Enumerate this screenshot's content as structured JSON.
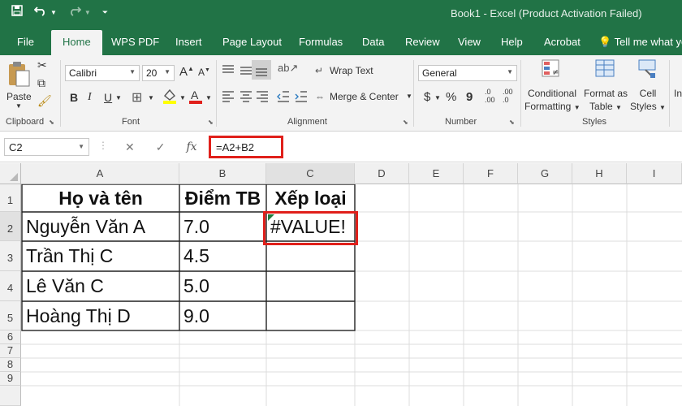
{
  "window": {
    "title": "Book1  -  Excel (Product Activation Failed)"
  },
  "quick_access": {
    "save_icon": "save-icon",
    "undo_icon": "undo-icon",
    "redo_icon": "redo-icon",
    "customize_icon": "customize-qat-icon"
  },
  "tabs": [
    "File",
    "Home",
    "WPS PDF",
    "Insert",
    "Page Layout",
    "Formulas",
    "Data",
    "Review",
    "View",
    "Help",
    "Acrobat",
    "Tell me what yo"
  ],
  "active_tab": "Home",
  "ribbon": {
    "clipboard": {
      "label": "Clipboard",
      "paste": "Paste"
    },
    "font": {
      "label": "Font",
      "family": "Calibri",
      "size": "20",
      "bold": "B",
      "italic": "I",
      "underline": "U",
      "grow": "A",
      "shrink": "A"
    },
    "alignment": {
      "label": "Alignment",
      "wrap": "Wrap Text",
      "merge": "Merge & Center"
    },
    "number": {
      "label": "Number",
      "format": "General",
      "currency": "$",
      "percent": "%",
      "comma": "9",
      "inc_decimal": ".00",
      "dec_decimal": ".0"
    },
    "styles": {
      "label": "Styles",
      "conditional": [
        "Conditional",
        "Formatting"
      ],
      "format_table": [
        "Format as",
        "Table"
      ],
      "cell_styles": [
        "Cell",
        "Styles"
      ]
    },
    "insert_partial": "In"
  },
  "formula_bar": {
    "name_box": "C2",
    "cancel": "✕",
    "enter": "✓",
    "fx": "fx",
    "formula": "=A2+B2"
  },
  "sheet": {
    "columns": [
      "A",
      "B",
      "C",
      "D",
      "E",
      "F",
      "G",
      "H",
      "I"
    ],
    "rows": [
      "1",
      "2",
      "3",
      "4",
      "5",
      "6",
      "7",
      "8",
      "9"
    ],
    "headers": [
      "Họ và tên",
      "Điểm TB",
      "Xếp loại"
    ],
    "data": [
      [
        "Nguyễn Văn A",
        "7.0",
        "#VALUE!"
      ],
      [
        "Trần Thị C",
        "4.5",
        ""
      ],
      [
        "Lê Văn C",
        "5.0",
        ""
      ],
      [
        "Hoàng Thị D",
        "9.0",
        ""
      ]
    ]
  },
  "colors": {
    "excel_green": "#217346",
    "highlight_red": "#e0201b"
  }
}
